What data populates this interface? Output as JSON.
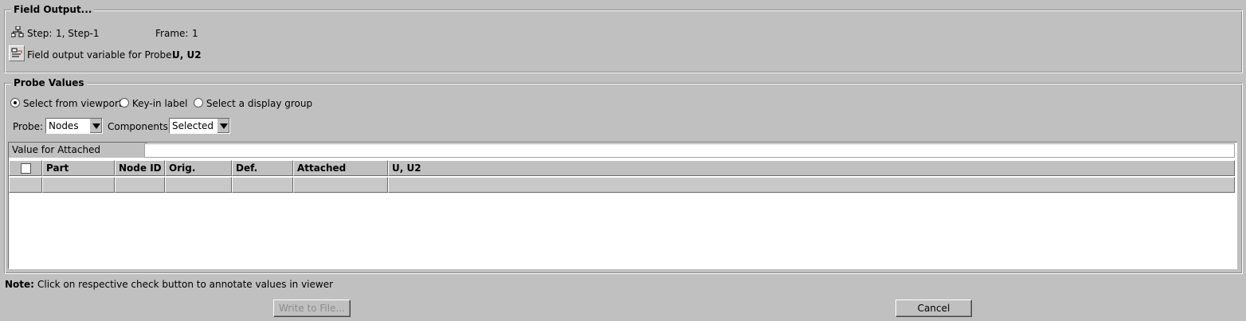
{
  "field_output": {
    "title": "Field Output...",
    "step_label": "Step:",
    "step_value": "1, Step-1",
    "frame_label": "Frame:",
    "frame_value": "1",
    "variable_label": "Field output variable for Probe:",
    "variable_value": "U, U2"
  },
  "probe_values": {
    "title": "Probe Values",
    "radios": [
      {
        "label": "Select from viewport",
        "selected": true
      },
      {
        "label": "Key-in label",
        "selected": false
      },
      {
        "label": "Select a display group",
        "selected": false
      }
    ],
    "probe_label": "Probe:",
    "probe_value": "Nodes",
    "components_label": "Components:",
    "components_value": "Selected",
    "value_attached_label": "Value for Attached elements:",
    "value_attached_value": "",
    "columns": [
      "Part Instance",
      "Node ID",
      "Orig. Coords",
      "Def. Coords",
      "Attached elements",
      "U, U2"
    ]
  },
  "note": {
    "label": "Note:",
    "text": "Click on respective check button to annotate values in viewer"
  },
  "buttons": {
    "write_to_file": "Write to File...",
    "cancel": "Cancel"
  },
  "icons": {
    "step": "step-tree-icon",
    "field": "field-output-icon"
  }
}
